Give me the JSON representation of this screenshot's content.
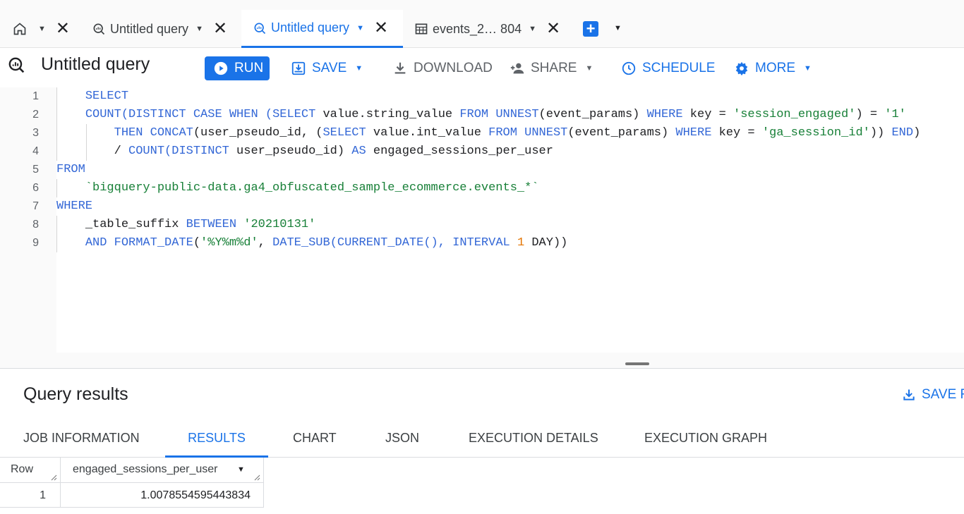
{
  "tabs": {
    "home_dropdown": "▼",
    "items": [
      {
        "label": "Untitled query",
        "icon": "query-icon"
      },
      {
        "label": "Untitled query",
        "icon": "query-icon"
      },
      {
        "label": "events_2… 804",
        "icon": "table-icon"
      }
    ],
    "add_label": "+",
    "dropdown": "▼"
  },
  "toolbar": {
    "title": "Untitled query",
    "run": "RUN",
    "save": "SAVE",
    "download": "DOWNLOAD",
    "share": "SHARE",
    "schedule": "SCHEDULE",
    "more": "MORE",
    "dropdown": "▼"
  },
  "editor": {
    "lines": [
      {
        "n": "1",
        "indent": "    ",
        "tokens": [
          [
            "kw",
            "SELECT"
          ]
        ]
      },
      {
        "n": "2",
        "indent": "    ",
        "tokens": [
          [
            "kw",
            "COUNT(DISTINCT CASE WHEN ("
          ],
          [
            "kw",
            "SELECT"
          ],
          [
            "",
            " value.string_value "
          ],
          [
            "kw",
            "FROM UNNEST"
          ],
          [
            "",
            "(event_params) "
          ],
          [
            "kw",
            "WHERE"
          ],
          [
            "",
            " key = "
          ],
          [
            "str",
            "'session_engaged'"
          ],
          [
            "",
            ") = "
          ],
          [
            "str",
            "'1'"
          ]
        ]
      },
      {
        "n": "3",
        "indent": "        ",
        "tokens": [
          [
            "kw",
            "THEN CONCAT"
          ],
          [
            "",
            "(user_pseudo_id, ("
          ],
          [
            "kw",
            "SELECT"
          ],
          [
            "",
            " value.int_value "
          ],
          [
            "kw",
            "FROM UNNEST"
          ],
          [
            "",
            "(event_params) "
          ],
          [
            "kw",
            "WHERE"
          ],
          [
            "",
            " key = "
          ],
          [
            "str",
            "'ga_session_id'"
          ],
          [
            "",
            ")) "
          ],
          [
            "kw",
            "END"
          ],
          [
            "",
            ")"
          ]
        ]
      },
      {
        "n": "4",
        "indent": "        ",
        "tokens": [
          [
            "",
            "/ "
          ],
          [
            "kw",
            "COUNT(DISTINCT"
          ],
          [
            "",
            " user_pseudo_id) "
          ],
          [
            "kw",
            "AS"
          ],
          [
            "",
            " engaged_sessions_per_user"
          ]
        ]
      },
      {
        "n": "5",
        "indent": "",
        "tokens": [
          [
            "kw",
            "FROM"
          ]
        ]
      },
      {
        "n": "6",
        "indent": "    ",
        "tokens": [
          [
            "str",
            "`bigquery-public-data.ga4_obfuscated_sample_ecommerce.events_*`"
          ]
        ]
      },
      {
        "n": "7",
        "indent": "",
        "tokens": [
          [
            "kw",
            "WHERE"
          ]
        ]
      },
      {
        "n": "8",
        "indent": "    ",
        "tokens": [
          [
            "",
            "_table_suffix "
          ],
          [
            "kw",
            "BETWEEN"
          ],
          [
            "",
            " "
          ],
          [
            "str",
            "'20210131'"
          ]
        ]
      },
      {
        "n": "9",
        "indent": "    ",
        "tokens": [
          [
            "kw",
            "AND FORMAT_DATE"
          ],
          [
            "",
            "("
          ],
          [
            "str",
            "'%Y%m%d'"
          ],
          [
            "",
            ", "
          ],
          [
            "kw",
            "DATE_SUB(CURRENT_DATE(), INTERVAL"
          ],
          [
            "",
            " "
          ],
          [
            "num",
            "1"
          ],
          [
            "",
            " DAY))"
          ]
        ]
      }
    ]
  },
  "results": {
    "title": "Query results",
    "save_results": "SAVE R",
    "tabs": [
      "JOB INFORMATION",
      "RESULTS",
      "CHART",
      "JSON",
      "EXECUTION DETAILS",
      "EXECUTION GRAPH"
    ],
    "columns": {
      "row": "Row",
      "field": "engaged_sessions_per_user",
      "dropdown": "▼"
    },
    "rows": [
      {
        "row": "1",
        "value": "1.0078554595443834"
      }
    ]
  },
  "colors": {
    "accent": "#1a73e8",
    "keyword": "#3367d6",
    "string": "#188038",
    "number": "#e37400"
  }
}
